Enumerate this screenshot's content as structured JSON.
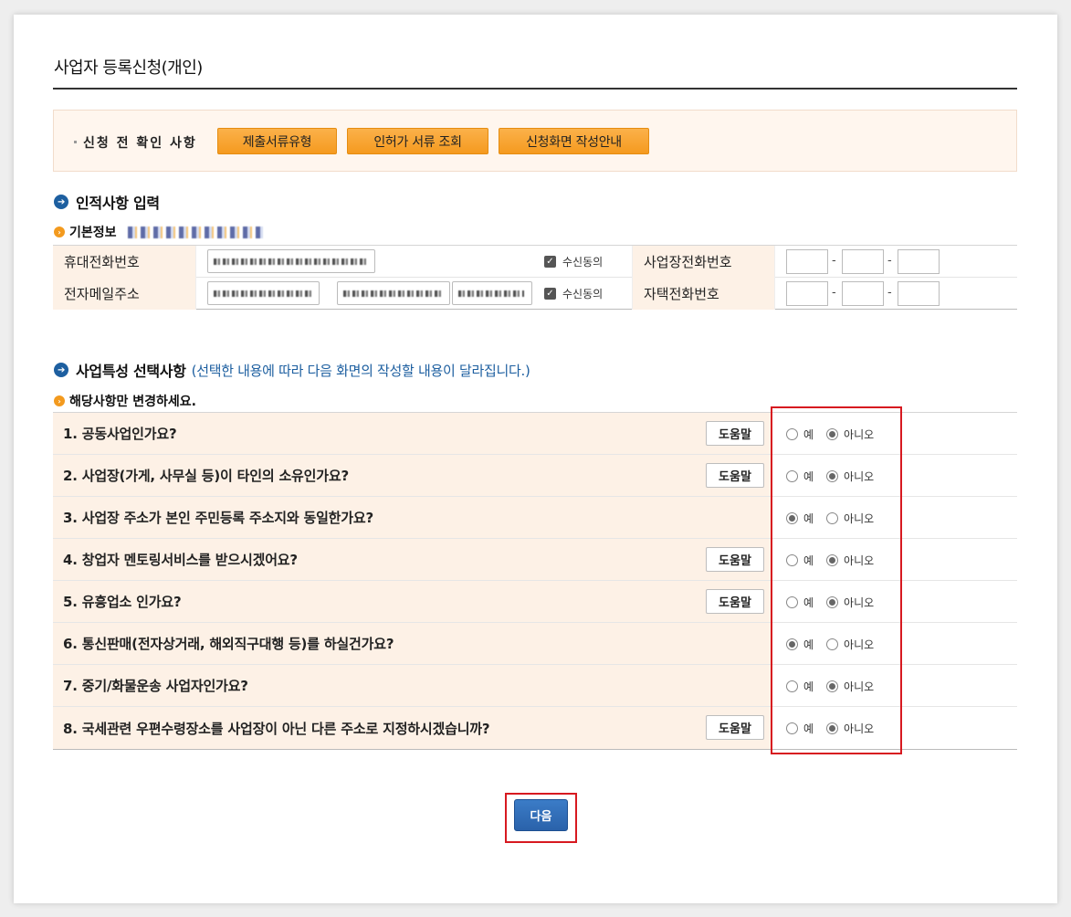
{
  "page": {
    "title": "사업자 등록신청(개인)"
  },
  "notice": {
    "label": "신청 전 확인 사항",
    "buttons": [
      "제출서류유형",
      "인허가 서류 조회",
      "신청화면 작성안내"
    ]
  },
  "personal": {
    "heading": "인적사항 입력",
    "subheading": "기본정보",
    "mobile_label": "휴대전화번호",
    "email_label": "전자메일주소",
    "consent_label": "수신동의",
    "biz_phone_label": "사업장전화번호",
    "home_phone_label": "자택전화번호",
    "dash": "-"
  },
  "business": {
    "heading": "사업특성 선택사항",
    "note": "(선택한 내용에 따라 다음 화면의 작성할 내용이 달라집니다.)",
    "subheading": "해당사항만 변경하세요.",
    "help_label": "도움말",
    "yes_label": "예",
    "no_label": "아니오",
    "questions": [
      {
        "text": "1. 공동사업인가요?",
        "help": true,
        "answer": "no"
      },
      {
        "text": "2. 사업장(가게, 사무실 등)이 타인의 소유인가요?",
        "help": true,
        "answer": "no"
      },
      {
        "text": "3. 사업장 주소가 본인 주민등록 주소지와 동일한가요?",
        "help": false,
        "answer": "yes"
      },
      {
        "text": "4. 창업자 멘토링서비스를 받으시겠어요?",
        "help": true,
        "answer": "no"
      },
      {
        "text": "5. 유흥업소 인가요?",
        "help": true,
        "answer": "no"
      },
      {
        "text": "6. 통신판매(전자상거래, 해외직구대행 등)를 하실건가요?",
        "help": false,
        "answer": "yes"
      },
      {
        "text": "7. 중기/화물운송 사업자인가요?",
        "help": false,
        "answer": "no"
      },
      {
        "text": "8. 국세관련 우편수령장소를 사업장이 아닌 다른 주소로 지정하시겠습니까?",
        "help": true,
        "answer": "no"
      }
    ]
  },
  "footer": {
    "next_label": "다음"
  },
  "colors": {
    "accent_blue": "#2a62aa",
    "accent_orange": "#f59a1f",
    "highlight_red": "#d71920"
  }
}
